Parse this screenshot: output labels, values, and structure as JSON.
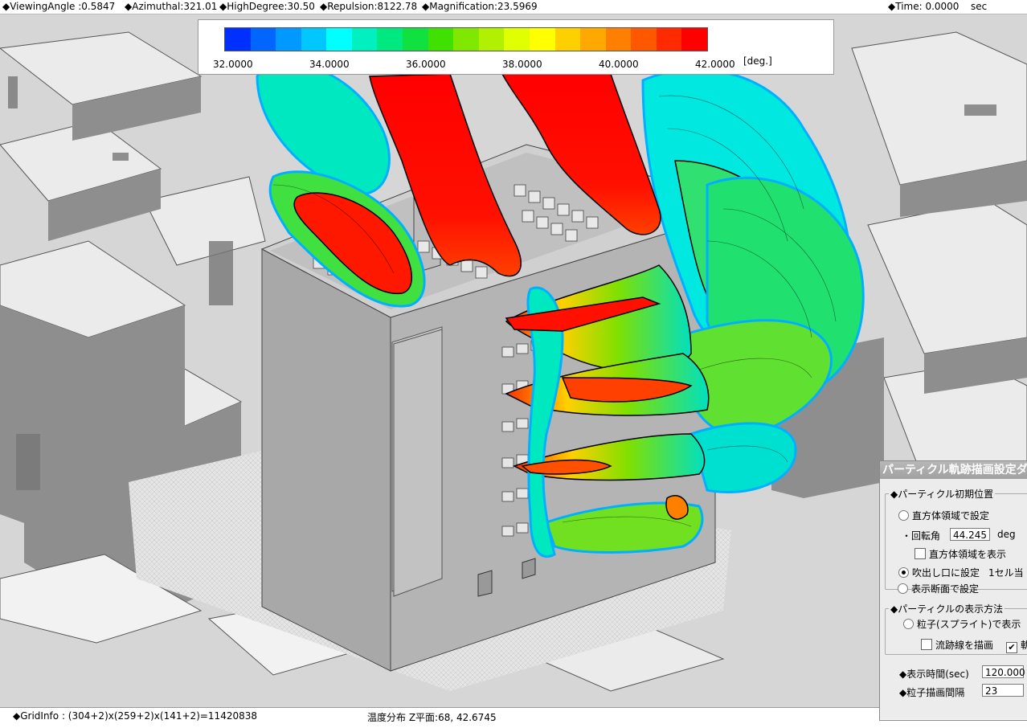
{
  "topbar": {
    "viewing_angle": "◆ViewingAngle :0.5847",
    "azimuthal": "◆Azimuthal:321.01",
    "high_degree": "◆HighDegree:30.50",
    "repulsion": "◆Repulsion:8122.78",
    "magnification": "◆Magnification:23.5969",
    "time": "◆Time: 0.0000",
    "time_unit": "sec"
  },
  "legend": {
    "colors": [
      "#0030ff",
      "#0066ff",
      "#0099ff",
      "#00c8ff",
      "#00ffff",
      "#00f0c0",
      "#00e880",
      "#10e040",
      "#40e000",
      "#80e800",
      "#b0f000",
      "#e0ff00",
      "#ffff00",
      "#ffd000",
      "#ffa800",
      "#ff8000",
      "#ff5800",
      "#ff2a00",
      "#ff0000"
    ],
    "ticks": [
      "32.0000",
      "34.0000",
      "36.0000",
      "38.0000",
      "40.0000",
      "42.0000"
    ],
    "unit": "[deg.]"
  },
  "bottombar": {
    "grid_info": "◆GridInfo : (304+2)x(259+2)x(141+2)=11420838",
    "status": "温度分布 Z平面:68, 42.6745"
  },
  "panel": {
    "title": "パーティクル軌跡描画設定ダ",
    "init_group": "◆パーティクル初期位置",
    "radio_box": "直方体領域で設定",
    "rotation_label": "・回転角",
    "rotation_value": "44.245",
    "rotation_unit": "deg",
    "show_box_check": "直方体領域を表示",
    "radio_outlet": "吹出し口に設定",
    "per_cell": "1セル当",
    "radio_section": "表示断面で設定",
    "display_group": "◆パーティクルの表示方法",
    "radio_sprite": "粒子(スプライト)で表示",
    "streamline_check": "流跡線を描画",
    "traj_check": "軌",
    "display_time_label": "◆表示時間(sec)",
    "display_time_value": "120.000",
    "interval_label": "◆粒子描画間隔",
    "interval_value": "23"
  }
}
